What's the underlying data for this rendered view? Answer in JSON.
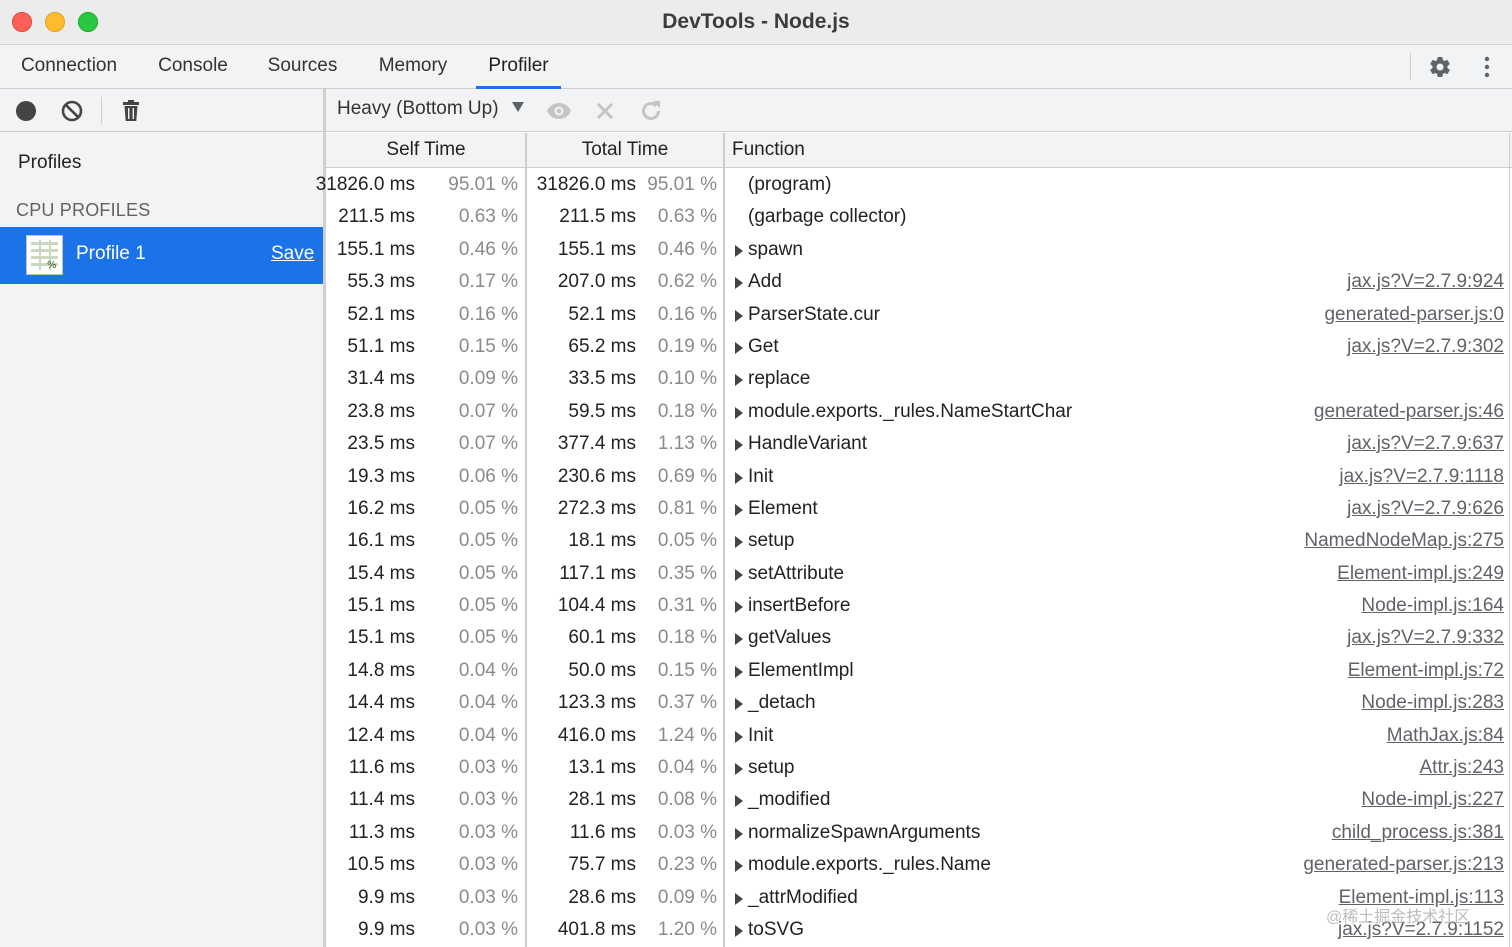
{
  "window": {
    "title": "DevTools - Node.js"
  },
  "tabs": [
    {
      "label": "Connection",
      "active": false
    },
    {
      "label": "Console",
      "active": false
    },
    {
      "label": "Sources",
      "active": false
    },
    {
      "label": "Memory",
      "active": false
    },
    {
      "label": "Profiler",
      "active": true
    }
  ],
  "icons": {
    "record": "record-icon",
    "clear": "clear-icon",
    "delete": "trash-icon",
    "settings": "gear-icon",
    "more": "more-vertical-icon",
    "focus": "eye-icon",
    "exclude": "close-icon",
    "restore": "refresh-icon"
  },
  "sidebar": {
    "heading": "Profiles",
    "section": "CPU PROFILES",
    "profile": {
      "name": "Profile 1",
      "save_label": "Save"
    }
  },
  "toolbar": {
    "view_mode": "Heavy (Bottom Up)"
  },
  "colors": {
    "accent": "#1a73e8",
    "selected_bg": "#1a73e8"
  },
  "table": {
    "headers": {
      "self": "Self Time",
      "total": "Total Time",
      "function": "Function"
    },
    "rows": [
      {
        "self": "31826.0 ms",
        "self_pct": "95.01 %",
        "total": "31826.0 ms",
        "total_pct": "95.01 %",
        "expandable": false,
        "fn": "(program)",
        "src": ""
      },
      {
        "self": "211.5 ms",
        "self_pct": "0.63 %",
        "total": "211.5 ms",
        "total_pct": "0.63 %",
        "expandable": false,
        "fn": "(garbage collector)",
        "src": ""
      },
      {
        "self": "155.1 ms",
        "self_pct": "0.46 %",
        "total": "155.1 ms",
        "total_pct": "0.46 %",
        "expandable": true,
        "fn": "spawn",
        "src": ""
      },
      {
        "self": "55.3 ms",
        "self_pct": "0.17 %",
        "total": "207.0 ms",
        "total_pct": "0.62 %",
        "expandable": true,
        "fn": "Add",
        "src": "jax.js?V=2.7.9:924"
      },
      {
        "self": "52.1 ms",
        "self_pct": "0.16 %",
        "total": "52.1 ms",
        "total_pct": "0.16 %",
        "expandable": true,
        "fn": "ParserState.cur",
        "src": "generated-parser.js:0"
      },
      {
        "self": "51.1 ms",
        "self_pct": "0.15 %",
        "total": "65.2 ms",
        "total_pct": "0.19 %",
        "expandable": true,
        "fn": "Get",
        "src": "jax.js?V=2.7.9:302"
      },
      {
        "self": "31.4 ms",
        "self_pct": "0.09 %",
        "total": "33.5 ms",
        "total_pct": "0.10 %",
        "expandable": true,
        "fn": "replace",
        "src": ""
      },
      {
        "self": "23.8 ms",
        "self_pct": "0.07 %",
        "total": "59.5 ms",
        "total_pct": "0.18 %",
        "expandable": true,
        "fn": "module.exports._rules.NameStartChar",
        "src": "generated-parser.js:46"
      },
      {
        "self": "23.5 ms",
        "self_pct": "0.07 %",
        "total": "377.4 ms",
        "total_pct": "1.13 %",
        "expandable": true,
        "fn": "HandleVariant",
        "src": "jax.js?V=2.7.9:637"
      },
      {
        "self": "19.3 ms",
        "self_pct": "0.06 %",
        "total": "230.6 ms",
        "total_pct": "0.69 %",
        "expandable": true,
        "fn": "Init",
        "src": "jax.js?V=2.7.9:1118"
      },
      {
        "self": "16.2 ms",
        "self_pct": "0.05 %",
        "total": "272.3 ms",
        "total_pct": "0.81 %",
        "expandable": true,
        "fn": "Element",
        "src": "jax.js?V=2.7.9:626"
      },
      {
        "self": "16.1 ms",
        "self_pct": "0.05 %",
        "total": "18.1 ms",
        "total_pct": "0.05 %",
        "expandable": true,
        "fn": "setup",
        "src": "NamedNodeMap.js:275"
      },
      {
        "self": "15.4 ms",
        "self_pct": "0.05 %",
        "total": "117.1 ms",
        "total_pct": "0.35 %",
        "expandable": true,
        "fn": "setAttribute",
        "src": "Element-impl.js:249"
      },
      {
        "self": "15.1 ms",
        "self_pct": "0.05 %",
        "total": "104.4 ms",
        "total_pct": "0.31 %",
        "expandable": true,
        "fn": "insertBefore",
        "src": "Node-impl.js:164"
      },
      {
        "self": "15.1 ms",
        "self_pct": "0.05 %",
        "total": "60.1 ms",
        "total_pct": "0.18 %",
        "expandable": true,
        "fn": "getValues",
        "src": "jax.js?V=2.7.9:332"
      },
      {
        "self": "14.8 ms",
        "self_pct": "0.04 %",
        "total": "50.0 ms",
        "total_pct": "0.15 %",
        "expandable": true,
        "fn": "ElementImpl",
        "src": "Element-impl.js:72"
      },
      {
        "self": "14.4 ms",
        "self_pct": "0.04 %",
        "total": "123.3 ms",
        "total_pct": "0.37 %",
        "expandable": true,
        "fn": "_detach",
        "src": "Node-impl.js:283"
      },
      {
        "self": "12.4 ms",
        "self_pct": "0.04 %",
        "total": "416.0 ms",
        "total_pct": "1.24 %",
        "expandable": true,
        "fn": "Init",
        "src": "MathJax.js:84"
      },
      {
        "self": "11.6 ms",
        "self_pct": "0.03 %",
        "total": "13.1 ms",
        "total_pct": "0.04 %",
        "expandable": true,
        "fn": "setup",
        "src": "Attr.js:243"
      },
      {
        "self": "11.4 ms",
        "self_pct": "0.03 %",
        "total": "28.1 ms",
        "total_pct": "0.08 %",
        "expandable": true,
        "fn": "_modified",
        "src": "Node-impl.js:227"
      },
      {
        "self": "11.3 ms",
        "self_pct": "0.03 %",
        "total": "11.6 ms",
        "total_pct": "0.03 %",
        "expandable": true,
        "fn": "normalizeSpawnArguments",
        "src": "child_process.js:381"
      },
      {
        "self": "10.5 ms",
        "self_pct": "0.03 %",
        "total": "75.7 ms",
        "total_pct": "0.23 %",
        "expandable": true,
        "fn": "module.exports._rules.Name",
        "src": "generated-parser.js:213"
      },
      {
        "self": "9.9 ms",
        "self_pct": "0.03 %",
        "total": "28.6 ms",
        "total_pct": "0.09 %",
        "expandable": true,
        "fn": "_attrModified",
        "src": "Element-impl.js:113"
      },
      {
        "self": "9.9 ms",
        "self_pct": "0.03 %",
        "total": "401.8 ms",
        "total_pct": "1.20 %",
        "expandable": true,
        "fn": "toSVG",
        "src": "jax.js?V=2.7.9:1152"
      }
    ]
  },
  "watermark": "@稀土掘金技术社区"
}
